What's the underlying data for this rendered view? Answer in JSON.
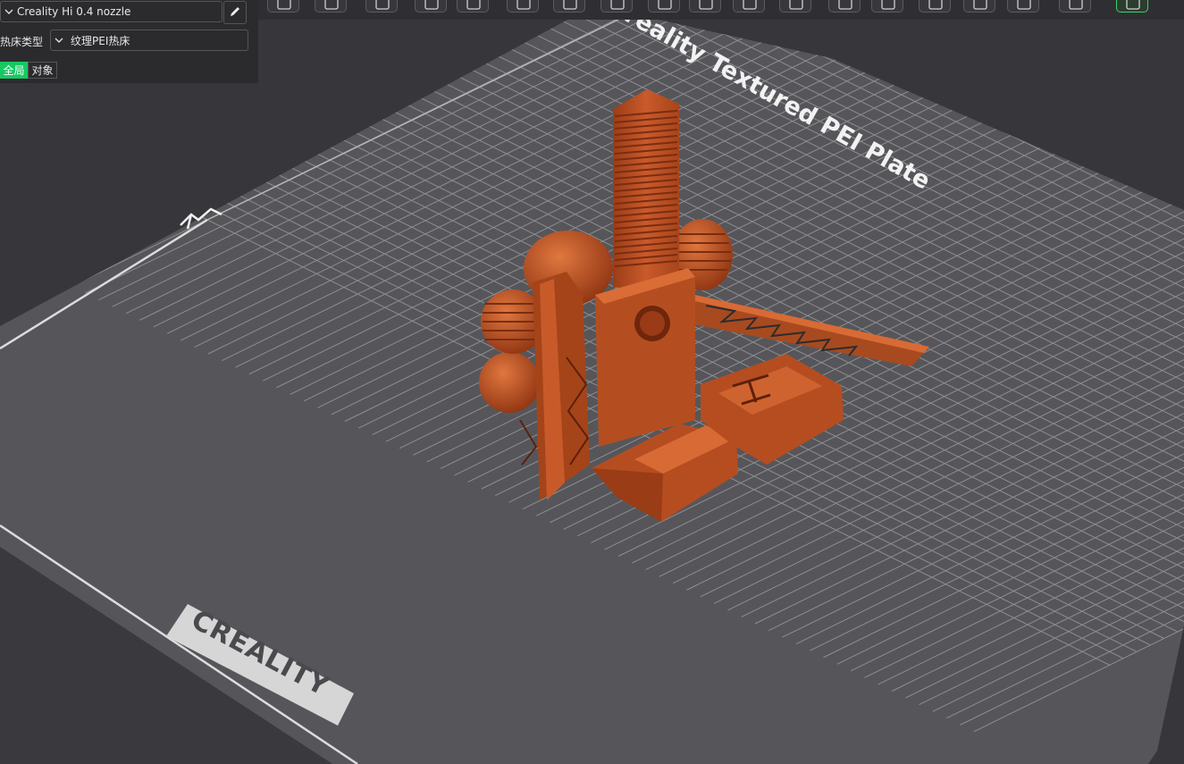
{
  "printer": {
    "name": "Creality Hi 0.4 nozzle",
    "edit_icon": "pencil-icon"
  },
  "bed_type": {
    "label": "热床类型",
    "value": "纹理PEI热床"
  },
  "scope_tabs": {
    "global": "全局",
    "object": "对象",
    "active": "global"
  },
  "plate": {
    "name": "Creality Textured PEI Plate",
    "logo": "CREALITY",
    "model_color": "#c8562a"
  },
  "toolbar": {
    "icons": [
      "cube-icon",
      "keyboard-icon",
      "arrange-icon",
      "orient-icon",
      "paint-icon",
      "layout-icon",
      "move-icon",
      "rotate-icon",
      "scale-icon",
      "cut-icon",
      "support-icon",
      "seam-icon",
      "fill-icon",
      "measure-icon",
      "assembly-icon",
      "text-icon",
      "emboss-icon",
      "view-icon",
      "brand-icon"
    ]
  },
  "colors": {
    "accent": "#17c863",
    "background": "#37373b",
    "plate": "#5a5a5e",
    "grid": "#8c8c90"
  }
}
